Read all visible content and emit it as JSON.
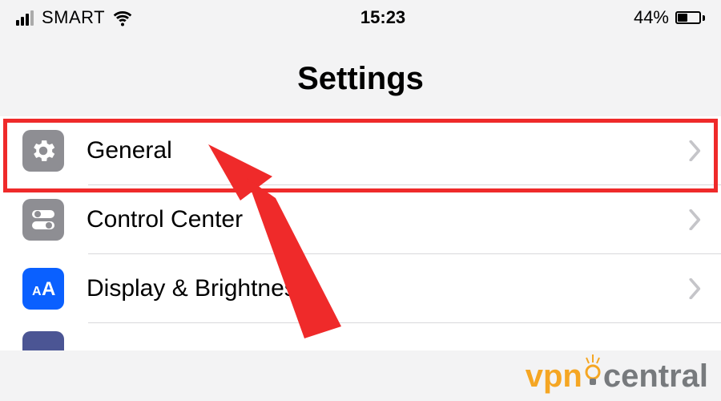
{
  "status_bar": {
    "carrier": "SMART",
    "time": "15:23",
    "battery_pct": "44%",
    "battery_fill_pct": 44
  },
  "header": {
    "title": "Settings"
  },
  "rows": {
    "general": {
      "label": "General"
    },
    "control_center": {
      "label": "Control Center"
    },
    "display": {
      "label": "Display & Brightness"
    }
  },
  "highlight": {
    "target_row": "general"
  },
  "watermark": {
    "left": "vpn",
    "right": "central"
  }
}
